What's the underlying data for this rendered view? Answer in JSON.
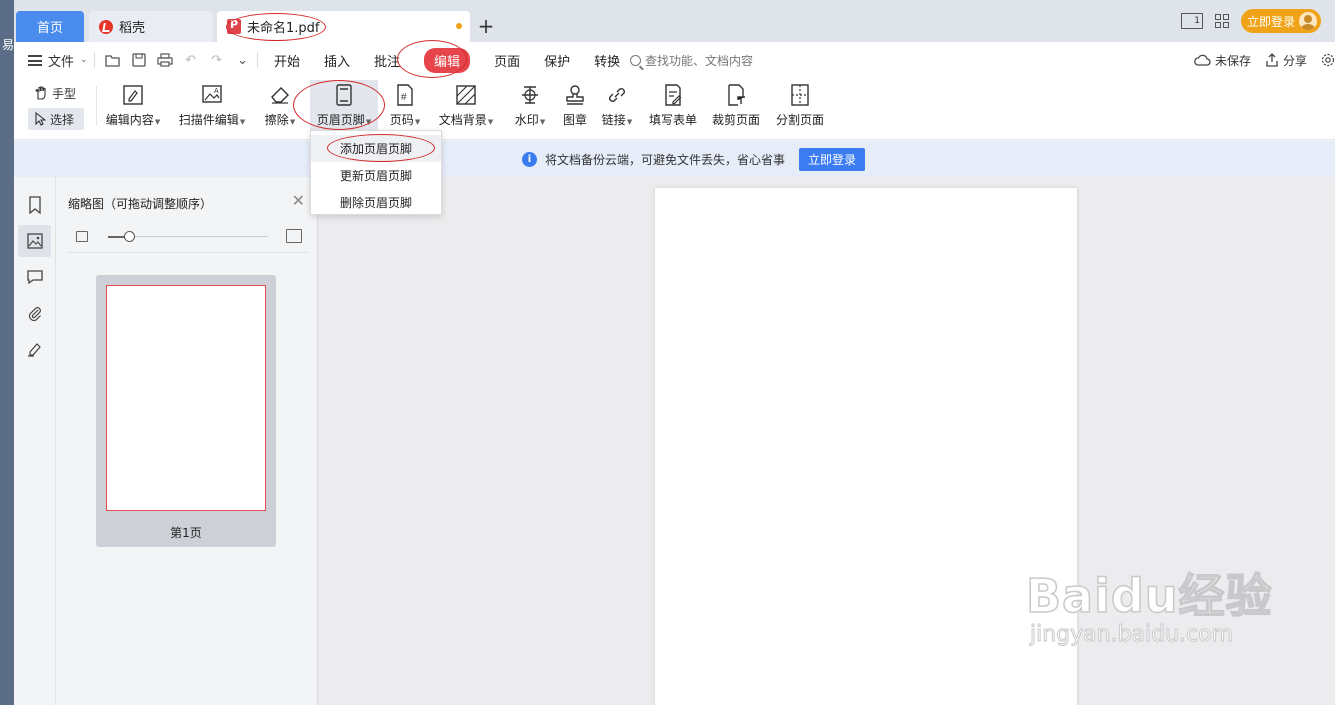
{
  "edge_char": "易",
  "tabs": {
    "home": "首页",
    "daoke": "稻壳",
    "document": "未命名1.pdf",
    "new_tab": "+"
  },
  "titlebar": {
    "page_indicator": "1",
    "login": "立即登录"
  },
  "menu": {
    "file": "文件",
    "tabs": [
      "开始",
      "插入",
      "批注",
      "编辑",
      "页面",
      "保护",
      "转换"
    ],
    "active_tab": "编辑",
    "search_placeholder": "查找功能、文档内容",
    "unsaved": "未保存",
    "share": "分享"
  },
  "ribbon": {
    "hand": "手型",
    "select": "选择",
    "tools": [
      {
        "label": "编辑内容",
        "caret": true
      },
      {
        "label": "扫描件编辑",
        "caret": true
      },
      {
        "label": "擦除",
        "caret": true
      },
      {
        "label": "页眉页脚",
        "caret": true
      },
      {
        "label": "页码",
        "caret": true
      },
      {
        "label": "文档背景",
        "caret": true
      },
      {
        "label": "水印",
        "caret": true
      },
      {
        "label": "图章",
        "caret": false
      },
      {
        "label": "链接",
        "caret": true
      },
      {
        "label": "填写表单",
        "caret": false
      },
      {
        "label": "裁剪页面",
        "caret": false
      },
      {
        "label": "分割页面",
        "caret": false
      }
    ]
  },
  "dropdown": {
    "items": [
      "添加页眉页脚",
      "更新页眉页脚",
      "删除页眉页脚"
    ]
  },
  "infobar": {
    "message": "将文档备份云端，可避免文件丢失，省心省事",
    "button": "立即登录"
  },
  "thumbnails": {
    "title": "缩略图（可拖动调整顺序）",
    "zoom_level": 0.13,
    "page_label": "第1页"
  },
  "watermark": {
    "brand": "Baidu经验",
    "url": "jingyan.baidu.com"
  },
  "colors": {
    "accent_blue": "#4a8bee",
    "active_tab_red": "#e6454b",
    "login_orange": "#f0a318",
    "annotation_red": "#d32a2a"
  }
}
